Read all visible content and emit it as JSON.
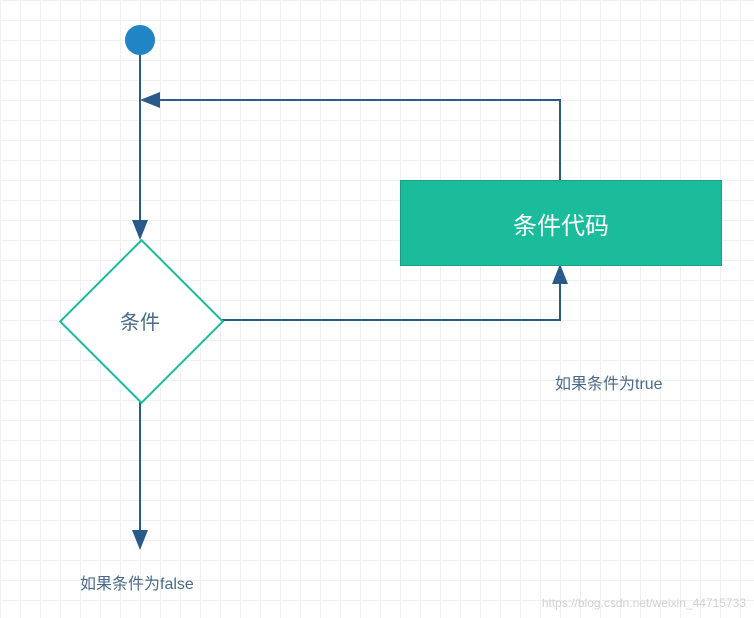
{
  "diagram": {
    "start_node": "start",
    "condition_label": "条件",
    "code_block_label": "条件代码",
    "true_branch_label": "如果条件为true",
    "false_branch_label": "如果条件为false"
  },
  "watermark": "https://blog.csdn.net/weixin_44715733",
  "colors": {
    "arrow_blue": "#2a5a8a",
    "node_teal": "#1abc9c",
    "start_blue": "#2185c5",
    "text_muted": "#4a6a8a"
  }
}
